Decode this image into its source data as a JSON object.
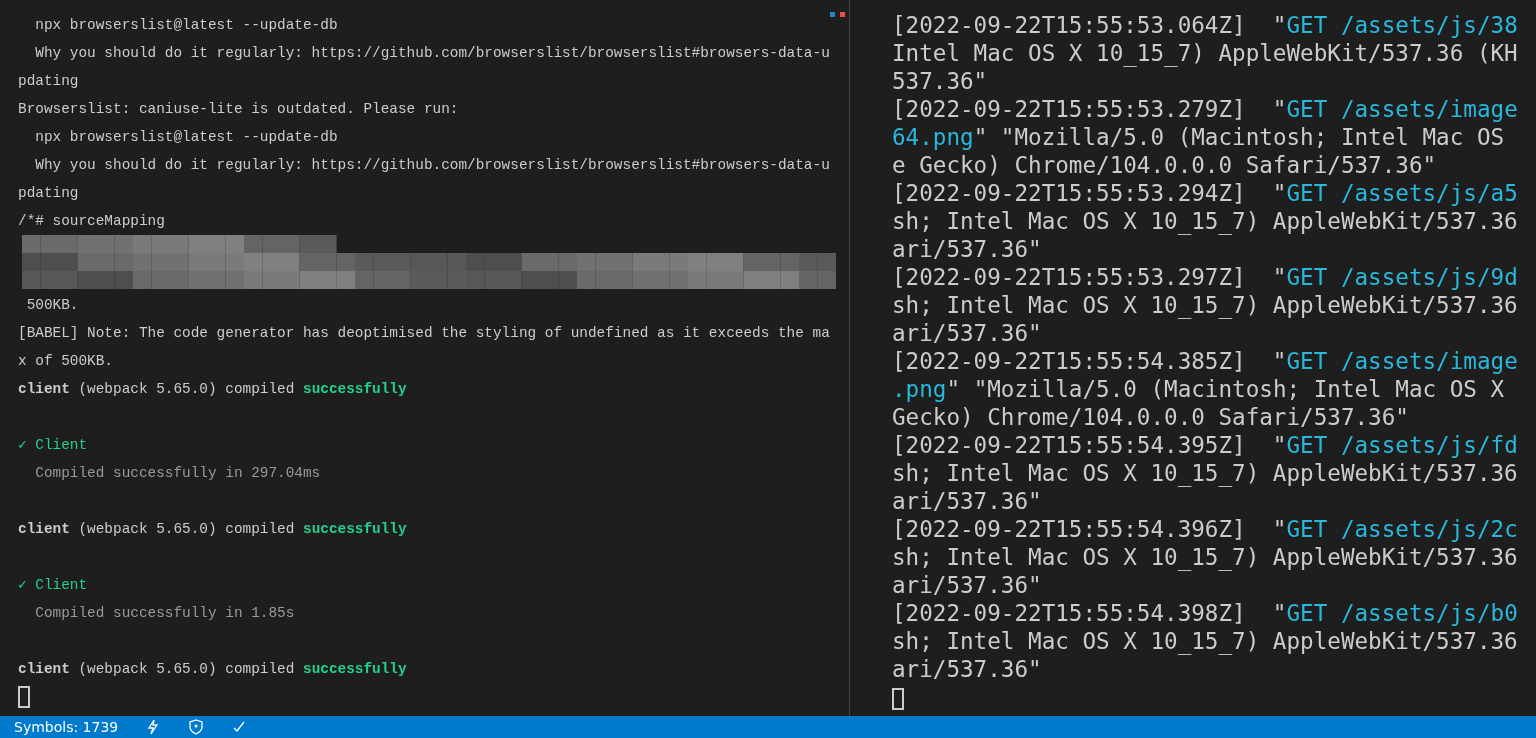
{
  "left_pane": {
    "markers": [
      {
        "color": "#1f87c9"
      },
      {
        "color": "#f14c4c"
      }
    ],
    "lines": [
      {
        "kind": "text",
        "segments": [
          {
            "kind": "plain",
            "text": "  npx browserslist@latest --update-db"
          }
        ]
      },
      {
        "kind": "text",
        "segments": [
          {
            "kind": "plain",
            "text": "  Why you should do it regularly: https://github.com/browserslist/browserslist#browsers-data-u"
          }
        ]
      },
      {
        "kind": "text",
        "segments": [
          {
            "kind": "plain",
            "text": "pdating"
          }
        ]
      },
      {
        "kind": "text",
        "segments": [
          {
            "kind": "plain",
            "text": "Browserslist: caniuse-lite is outdated. Please run:"
          }
        ]
      },
      {
        "kind": "text",
        "segments": [
          {
            "kind": "plain",
            "text": "  npx browserslist@latest --update-db"
          }
        ]
      },
      {
        "kind": "text",
        "segments": [
          {
            "kind": "plain",
            "text": "  Why you should do it regularly: https://github.com/browserslist/browserslist#browsers-data-u"
          }
        ]
      },
      {
        "kind": "text",
        "segments": [
          {
            "kind": "plain",
            "text": "pdating"
          }
        ]
      },
      {
        "kind": "text",
        "segments": [
          {
            "kind": "plain",
            "text": "/*# sourceMapping"
          }
        ]
      },
      {
        "kind": "redacted"
      },
      {
        "kind": "text",
        "segments": [
          {
            "kind": "plain",
            "text": " 500KB."
          }
        ]
      },
      {
        "kind": "text",
        "segments": [
          {
            "kind": "plain",
            "text": "[BABEL] Note: The code generator has deoptimised the styling of undefined as it exceeds the ma"
          }
        ]
      },
      {
        "kind": "text",
        "segments": [
          {
            "kind": "plain",
            "text": "x of 500KB."
          }
        ]
      },
      {
        "kind": "text",
        "segments": [
          {
            "kind": "bold",
            "text": "client"
          },
          {
            "kind": "plain",
            "text": " (webpack 5.65.0) compiled "
          },
          {
            "kind": "success",
            "text": "successfully"
          }
        ]
      },
      {
        "kind": "blank"
      },
      {
        "kind": "text",
        "segments": [
          {
            "kind": "green",
            "text": "✓ Client"
          }
        ]
      },
      {
        "kind": "text",
        "segments": [
          {
            "kind": "dim",
            "text": "  Compiled successfully in 297.04ms"
          }
        ]
      },
      {
        "kind": "blank"
      },
      {
        "kind": "text",
        "segments": [
          {
            "kind": "bold",
            "text": "client"
          },
          {
            "kind": "plain",
            "text": " (webpack 5.65.0) compiled "
          },
          {
            "kind": "success",
            "text": "successfully"
          }
        ]
      },
      {
        "kind": "blank"
      },
      {
        "kind": "text",
        "segments": [
          {
            "kind": "green",
            "text": "✓ Client"
          }
        ]
      },
      {
        "kind": "text",
        "segments": [
          {
            "kind": "dim",
            "text": "  Compiled successfully in 1.85s"
          }
        ]
      },
      {
        "kind": "blank"
      },
      {
        "kind": "text",
        "segments": [
          {
            "kind": "bold",
            "text": "client"
          },
          {
            "kind": "plain",
            "text": " (webpack 5.65.0) compiled "
          },
          {
            "kind": "success",
            "text": "successfully"
          }
        ]
      },
      {
        "kind": "cursor"
      }
    ]
  },
  "right_pane": {
    "lines": [
      {
        "kind": "text",
        "segments": [
          {
            "kind": "plain",
            "text": "[2022-09-22T15:55:53.064Z]  \""
          },
          {
            "kind": "link",
            "text": "GET /assets/js/38"
          }
        ]
      },
      {
        "kind": "text",
        "segments": [
          {
            "kind": "plain",
            "text": "Intel Mac OS X 10_15_7) AppleWebKit/537.36 (KH"
          }
        ]
      },
      {
        "kind": "text",
        "segments": [
          {
            "kind": "plain",
            "text": "537.36\""
          }
        ]
      },
      {
        "kind": "text",
        "segments": [
          {
            "kind": "plain",
            "text": "[2022-09-22T15:55:53.279Z]  \""
          },
          {
            "kind": "link",
            "text": "GET /assets/image"
          }
        ]
      },
      {
        "kind": "text",
        "segments": [
          {
            "kind": "link",
            "text": "64.png"
          },
          {
            "kind": "plain",
            "text": "\" \"Mozilla/5.0 (Macintosh; Intel Mac OS"
          }
        ]
      },
      {
        "kind": "text",
        "segments": [
          {
            "kind": "plain",
            "text": "e Gecko) Chrome/104.0.0.0 Safari/537.36\""
          }
        ]
      },
      {
        "kind": "text",
        "segments": [
          {
            "kind": "plain",
            "text": "[2022-09-22T15:55:53.294Z]  \""
          },
          {
            "kind": "link",
            "text": "GET /assets/js/a5"
          }
        ]
      },
      {
        "kind": "text",
        "segments": [
          {
            "kind": "plain",
            "text": "sh; Intel Mac OS X 10_15_7) AppleWebKit/537.36"
          }
        ]
      },
      {
        "kind": "text",
        "segments": [
          {
            "kind": "plain",
            "text": "ari/537.36\""
          }
        ]
      },
      {
        "kind": "text",
        "segments": [
          {
            "kind": "plain",
            "text": "[2022-09-22T15:55:53.297Z]  \""
          },
          {
            "kind": "link",
            "text": "GET /assets/js/9d"
          }
        ]
      },
      {
        "kind": "text",
        "segments": [
          {
            "kind": "plain",
            "text": "sh; Intel Mac OS X 10_15_7) AppleWebKit/537.36"
          }
        ]
      },
      {
        "kind": "text",
        "segments": [
          {
            "kind": "plain",
            "text": "ari/537.36\""
          }
        ]
      },
      {
        "kind": "text",
        "segments": [
          {
            "kind": "plain",
            "text": "[2022-09-22T15:55:54.385Z]  \""
          },
          {
            "kind": "link",
            "text": "GET /assets/image"
          }
        ]
      },
      {
        "kind": "text",
        "segments": [
          {
            "kind": "link",
            "text": ".png"
          },
          {
            "kind": "plain",
            "text": "\" \"Mozilla/5.0 (Macintosh; Intel Mac OS X"
          }
        ]
      },
      {
        "kind": "text",
        "segments": [
          {
            "kind": "plain",
            "text": "Gecko) Chrome/104.0.0.0 Safari/537.36\""
          }
        ]
      },
      {
        "kind": "text",
        "segments": [
          {
            "kind": "plain",
            "text": "[2022-09-22T15:55:54.395Z]  \""
          },
          {
            "kind": "link",
            "text": "GET /assets/js/fd"
          }
        ]
      },
      {
        "kind": "text",
        "segments": [
          {
            "kind": "plain",
            "text": "sh; Intel Mac OS X 10_15_7) AppleWebKit/537.36"
          }
        ]
      },
      {
        "kind": "text",
        "segments": [
          {
            "kind": "plain",
            "text": "ari/537.36\""
          }
        ]
      },
      {
        "kind": "text",
        "segments": [
          {
            "kind": "plain",
            "text": "[2022-09-22T15:55:54.396Z]  \""
          },
          {
            "kind": "link",
            "text": "GET /assets/js/2c"
          }
        ]
      },
      {
        "kind": "text",
        "segments": [
          {
            "kind": "plain",
            "text": "sh; Intel Mac OS X 10_15_7) AppleWebKit/537.36"
          }
        ]
      },
      {
        "kind": "text",
        "segments": [
          {
            "kind": "plain",
            "text": "ari/537.36\""
          }
        ]
      },
      {
        "kind": "text",
        "segments": [
          {
            "kind": "plain",
            "text": "[2022-09-22T15:55:54.398Z]  \""
          },
          {
            "kind": "link",
            "text": "GET /assets/js/b0"
          }
        ]
      },
      {
        "kind": "text",
        "segments": [
          {
            "kind": "plain",
            "text": "sh; Intel Mac OS X 10_15_7) AppleWebKit/537.36"
          }
        ]
      },
      {
        "kind": "text",
        "segments": [
          {
            "kind": "plain",
            "text": "ari/537.36\""
          }
        ]
      },
      {
        "kind": "cursor"
      }
    ]
  },
  "status_bar": {
    "symbols": "Symbols: 1739"
  }
}
